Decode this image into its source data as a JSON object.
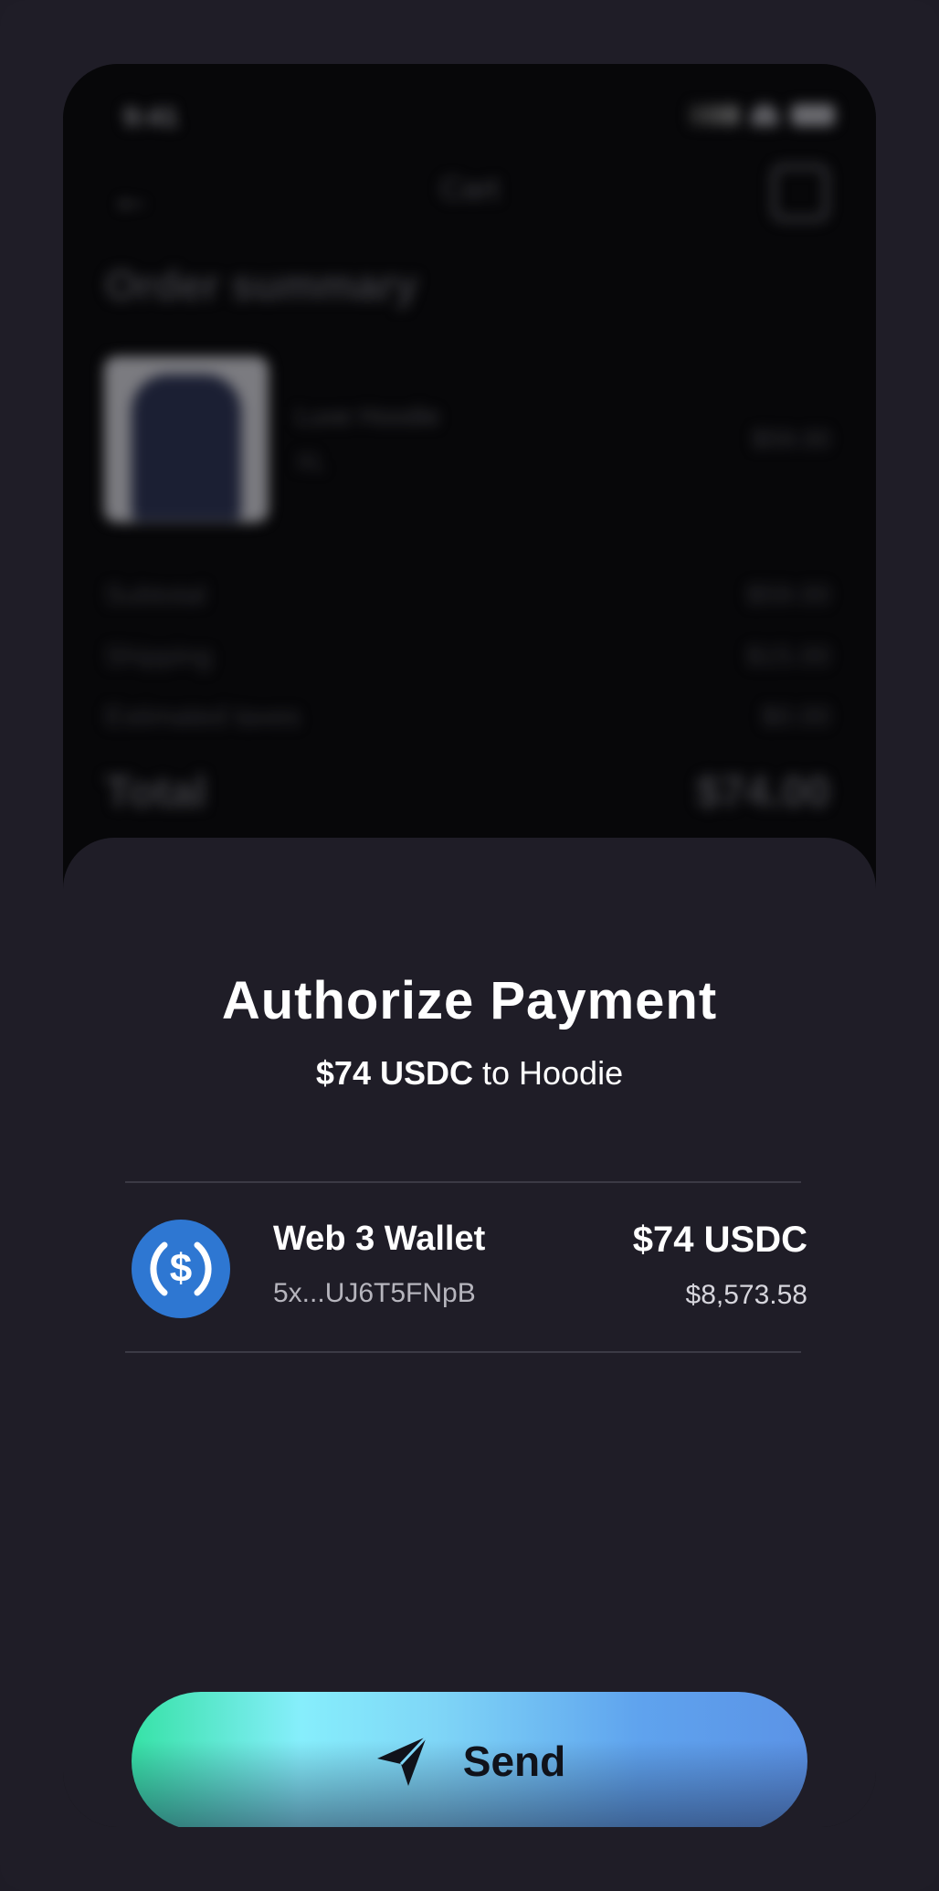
{
  "background_app": {
    "status_time": "9:41",
    "nav_title": "Cart",
    "heading": "Order summary",
    "item": {
      "name": "Luxe Hoodie",
      "size": "XL",
      "price": "$59.00"
    },
    "rows": [
      {
        "label": "Subtotal",
        "value": "$59.00"
      },
      {
        "label": "Shipping",
        "value": "$15.00"
      },
      {
        "label": "Estimated taxes",
        "value": "$0.00"
      }
    ],
    "total": {
      "label": "Total",
      "value": "$74.00"
    }
  },
  "sheet": {
    "title": "Authorize Payment",
    "subtitle_amount": "$74 USDC",
    "subtitle_rest": " to Hoodie",
    "wallet": {
      "name": "Web 3 Wallet",
      "address": "5x...UJ6T5FNpB",
      "amount": "$74 USDC",
      "balance": "$8,573.58",
      "icon": "usdc-icon"
    },
    "send_label": "Send"
  },
  "colors": {
    "sheet_bg": "#1f1d27",
    "usdc_blue": "#2e77d2",
    "button_gradient": [
      "#36e2a6",
      "#86eefc",
      "#5b93e6"
    ]
  }
}
